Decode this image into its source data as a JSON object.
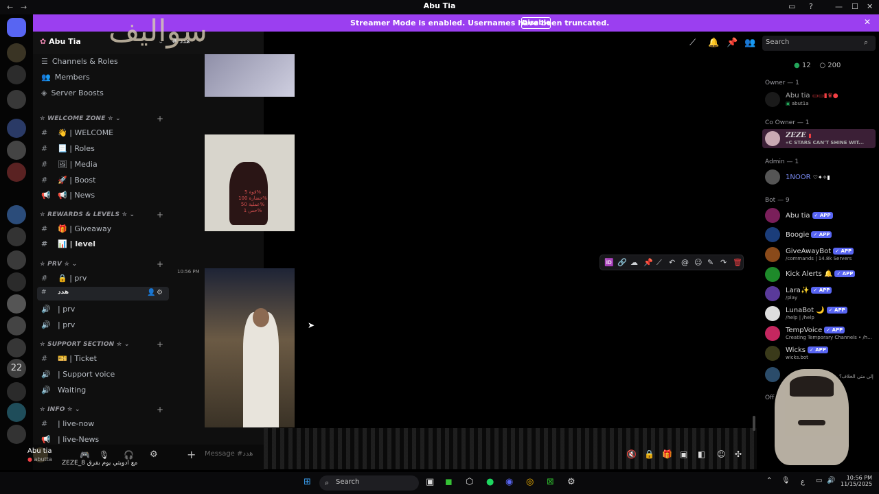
{
  "window": {
    "title": "Abu Tia",
    "nav_back": "←",
    "nav_forward": "→"
  },
  "banner": {
    "message": "Streamer Mode is enabled. Usernames have been truncated.",
    "disable_label": "Disable",
    "close": "✕"
  },
  "server": {
    "name": "Abu Tia",
    "calligraphy": "سواليف",
    "current_channel": "هدد"
  },
  "server_list": {
    "number_badge": "22"
  },
  "sidebar": {
    "top_items": [
      {
        "label": "Channels & Roles"
      },
      {
        "label": "Members"
      },
      {
        "label": "Server Boosts"
      }
    ],
    "categories": [
      {
        "name": "✮ WELCOME ZONE ✮",
        "channels": [
          "👋 | WELCOME",
          "📃 | Roles",
          "🖼 | Media",
          "🚀 | Boost",
          "📢 | News"
        ]
      },
      {
        "name": "✮ REWARDS & LEVELS ✮",
        "channels": [
          "🎁 | Giveaway",
          "📊 | level"
        ]
      },
      {
        "name": "✮ PRV ✮",
        "channels": [
          "🔒 | prv",
          "هدد",
          "| prv",
          "| prv"
        ]
      },
      {
        "name": "✮ SUPPORT SECTION ✮",
        "channels": [
          "🎫 | Ticket",
          "| Support voice",
          "Waiting"
        ]
      },
      {
        "name": "✮ INFO ✮",
        "channels": [
          "| live-now",
          "| live-News"
        ]
      }
    ]
  },
  "user_panel": {
    "name": "Abu tia",
    "status": "abutta",
    "activity": "ZEZE_8 مع ادويتي يوم بفرق"
  },
  "chat": {
    "timestamp": "10:56 PM",
    "image_text": "قوة 5%\nحضارة 100%\nعملية 50%\nحس 1%",
    "composer_placeholder": "Message #هدد"
  },
  "header": {
    "search_placeholder": "Search"
  },
  "members": {
    "online_count": "12",
    "total_count": "200",
    "groups": [
      {
        "title": "Owner — 1",
        "members": [
          {
            "name": "Abu tia",
            "sub": "abut1a"
          }
        ]
      },
      {
        "title": "Co Owner — 1",
        "members": [
          {
            "name": "ZEZE",
            "sub": "«C STARS CAN'T SHINE WIT..."
          }
        ]
      },
      {
        "title": "Admin — 1",
        "members": [
          {
            "name": "1NOOR",
            "sub": ""
          }
        ]
      },
      {
        "title": "Bot — 9",
        "members": [
          {
            "name": "Abu tia",
            "sub": ""
          },
          {
            "name": "Boogie",
            "sub": ""
          },
          {
            "name": "GiveAwayBot",
            "sub": "/commands | 14.8k Servers"
          },
          {
            "name": "Kick Alerts 🔔",
            "sub": ""
          },
          {
            "name": "Lara✨",
            "sub": "/play"
          },
          {
            "name": "LunaBot 🌙",
            "sub": "/help | /help"
          },
          {
            "name": "TempVoice",
            "sub": "Creating Temporary Channels • /h..."
          },
          {
            "name": "Wicks",
            "sub": "wicks.bot"
          },
          {
            "name": "",
            "sub": "إلى متى الخلاف؟"
          }
        ]
      }
    ],
    "offline_label": "Off",
    "app_tag": "APP"
  },
  "taskbar": {
    "search_label": "Search",
    "time": "10:56 PM",
    "date": "11/15/2025",
    "language": "ع"
  }
}
